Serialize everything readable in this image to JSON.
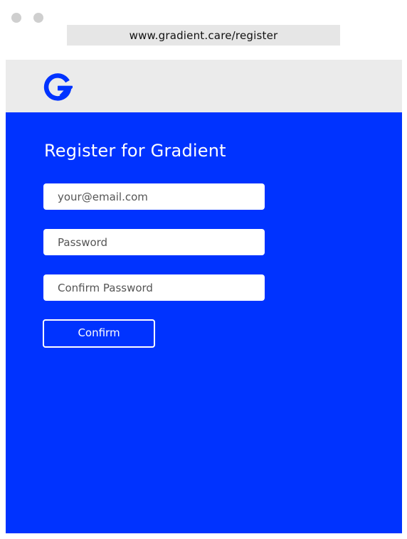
{
  "browser": {
    "url": "www.gradient.care/register"
  },
  "header": {
    "logo_icon": "gradient-g-logo-icon",
    "logo_color": "#0033ff"
  },
  "register": {
    "title": "Register for Gradient",
    "email_placeholder": "your@email.com",
    "password_placeholder": "Password",
    "confirm_password_placeholder": "Confirm Password",
    "confirm_label": "Confirm"
  },
  "colors": {
    "accent": "#0033ff",
    "header_bg": "#ebebeb",
    "url_bar_bg": "#e6e6e6"
  }
}
